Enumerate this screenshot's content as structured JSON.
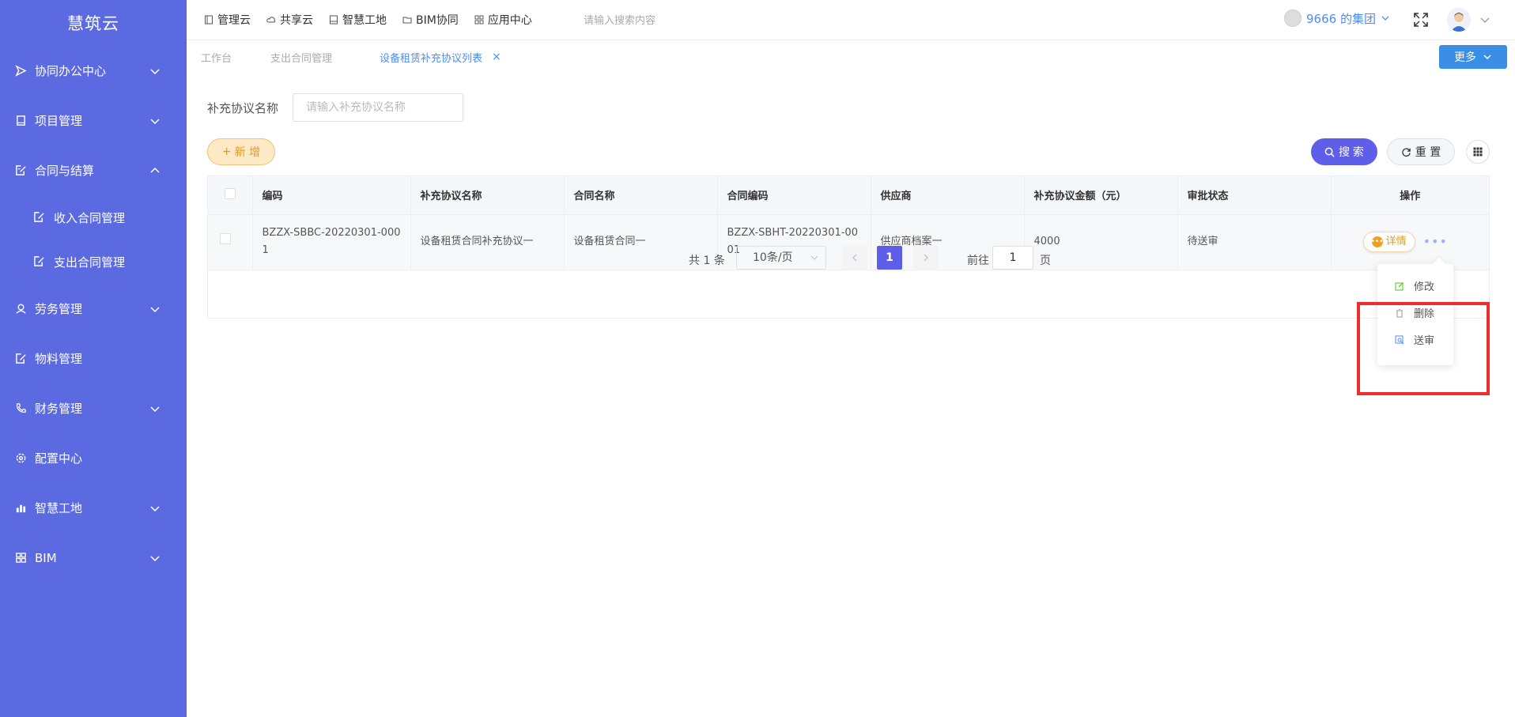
{
  "brand": "慧筑云",
  "sidebar": {
    "items": [
      {
        "label": "协同办公中心",
        "icon": "send-icon",
        "expanded": false
      },
      {
        "label": "项目管理",
        "icon": "book-icon",
        "expanded": false
      },
      {
        "label": "合同与结算",
        "icon": "edit-doc-icon",
        "expanded": true,
        "children": [
          {
            "label": "收入合同管理"
          },
          {
            "label": "支出合同管理"
          }
        ]
      },
      {
        "label": "劳务管理",
        "icon": "worker-icon",
        "expanded": false
      },
      {
        "label": "物料管理",
        "icon": "edit-doc-icon",
        "expanded": false
      },
      {
        "label": "财务管理",
        "icon": "phone-icon",
        "expanded": false
      },
      {
        "label": "配置中心",
        "icon": "gear-icon",
        "expanded": false
      },
      {
        "label": "智慧工地",
        "icon": "bar-chart-icon",
        "expanded": false
      },
      {
        "label": "BIM",
        "icon": "grid-icon",
        "expanded": false
      }
    ]
  },
  "topnav": {
    "items": [
      {
        "label": "管理云"
      },
      {
        "label": "共享云"
      },
      {
        "label": "智慧工地"
      },
      {
        "label": "BIM协同"
      },
      {
        "label": "应用中心"
      }
    ],
    "search_placeholder": "请输入搜索内容",
    "org": "9666 的集团"
  },
  "tabs": {
    "items": [
      {
        "label": "工作台"
      },
      {
        "label": "支出合同管理"
      },
      {
        "label": "设备租赁补充协议列表"
      }
    ],
    "close": "×",
    "more": "更多"
  },
  "filter": {
    "label": "补充协议名称",
    "placeholder": "请输入补充协议名称"
  },
  "buttons": {
    "add": "新 增",
    "add_prefix": "+",
    "search": "搜 索",
    "reset": "重 置"
  },
  "table": {
    "headers": [
      "编码",
      "补充协议名称",
      "合同名称",
      "合同编码",
      "供应商",
      "补充协议金额（元）",
      "审批状态",
      "操作"
    ],
    "rows": [
      {
        "code": "BZZX-SBBC-20220301-0001",
        "name": "设备租赁合同补充协议一",
        "contract_name": "设备租赁合同一",
        "contract_code": "BZZX-SBHT-20220301-0001",
        "supplier": "供应商档案一",
        "amount": "4000",
        "status": "待送审",
        "detail": "详情"
      }
    ]
  },
  "pager": {
    "total": "共 1 条",
    "size": "10条/页",
    "current": "1",
    "goto": "前往",
    "goto_value": "1",
    "unit": "页"
  },
  "dropdown": {
    "items": [
      {
        "label": "修改",
        "icon": "edit-icon",
        "color": "#52c41a"
      },
      {
        "label": "删除",
        "icon": "trash-icon",
        "color": "#999999"
      },
      {
        "label": "送审",
        "icon": "submit-review-icon",
        "color": "#4e8cf7"
      }
    ]
  }
}
